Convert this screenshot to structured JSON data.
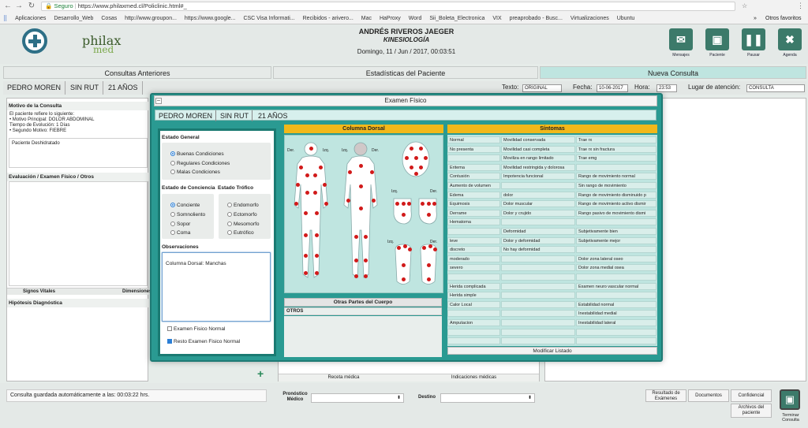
{
  "browser": {
    "secure_label": "Seguro",
    "url": "https://www.philaxmed.cl/Policlinic.html#_",
    "bookmarks": [
      "Aplicaciones",
      "Desarrollo_Web",
      "Cosas",
      "http://www.groupon...",
      "https://www.google...",
      "CSC Visa Informati...",
      "Recibidos - arivero...",
      "Mac",
      "HaProxy",
      "Word",
      "Sii_Boleta_Electronica",
      "VIX",
      "preaprobado - Busc...",
      "Virtualizaciones",
      "Ubuntu"
    ],
    "other_bookmarks": "Otros favoritos",
    "more": "»"
  },
  "brand": {
    "line1": "philax",
    "line2": "med"
  },
  "doctor": {
    "name": "ANDRÉS RIVEROS JAEGER",
    "specialty": "KINESIOLOGÍA",
    "datetime": "Domingo, 11 / Jun / 2017, 00:03:51"
  },
  "toolbar": [
    {
      "label": "Mensajes",
      "icon": "envelope-icon",
      "glyph": "✉"
    },
    {
      "label": "Paciente",
      "icon": "patient-card-icon",
      "glyph": "▣"
    },
    {
      "label": "Pausar",
      "icon": "pause-icon",
      "glyph": "❚❚"
    },
    {
      "label": "Agenda",
      "icon": "close-x-icon",
      "glyph": "✖"
    }
  ],
  "tabs": [
    "Consultas Anteriores",
    "Estadísticas del Paciente",
    "Nueva Consulta"
  ],
  "patient": {
    "name": "PEDRO MOREN",
    "rut": "SIN RUT",
    "age": "21 AÑOS"
  },
  "consult": {
    "texto_label": "Texto:",
    "texto_value": "ORIGINAL",
    "fecha_label": "Fecha:",
    "fecha_value": "10-06-2017",
    "hora_label": "Hora:",
    "hora_value": "23:53",
    "lugar_label": "Lugar de atención:",
    "lugar_value": "CONSULTA"
  },
  "left": {
    "motivo_title": "Motivo de la Consulta",
    "motivo_lines": [
      "El paciente refiere lo siguiente:",
      "• Motivo Principal: DOLOR ABDOMINAL",
      "Tiempo de Evolución: 1 Días",
      "• Segundo Motivo: FIEBRE"
    ],
    "motivo_extra": "Paciente Deshidratado",
    "eval_title": "Evaluación / Examen Físico / Otros",
    "signos": "Signos Vitales",
    "dimensiones": "Dimensiones",
    "hipotesis_title": "Hipótesis Diagnóstica",
    "add": "+"
  },
  "middle_bottom": {
    "receta": "Receta médica",
    "indicaciones": "Indicaciones médicas"
  },
  "footer": {
    "save_msg": "Consulta guardada automáticamente a las: 00:03:22 hrs.",
    "pronostico_label": "Pronóstico Médico",
    "destino_label": "Destino",
    "buttons": [
      "Resultado de Exámenes",
      "Documentos",
      "Confidencial",
      "Archivos del paciente"
    ],
    "terminar": "Terminar Consulta"
  },
  "modal": {
    "title": "Examen Físico",
    "estado_general": {
      "label": "Estado General",
      "options": [
        {
          "label": "Buenas Condiciones",
          "selected": true
        },
        {
          "label": "Regulares Condiciones",
          "selected": false
        },
        {
          "label": "Malas Condiciones",
          "selected": false
        }
      ]
    },
    "conciencia": {
      "label": "Estado de Conciencia",
      "options": [
        {
          "label": "Conciente",
          "selected": true
        },
        {
          "label": "Somnoliento",
          "selected": false
        },
        {
          "label": "Sopor",
          "selected": false
        },
        {
          "label": "Coma",
          "selected": false
        }
      ]
    },
    "trofico": {
      "label": "Estado Trófico",
      "options": [
        {
          "label": "Endomorfo",
          "selected": false
        },
        {
          "label": "Ectomorfo",
          "selected": false
        },
        {
          "label": "Mesomorfo",
          "selected": false
        },
        {
          "label": "Eutrófico",
          "selected": false
        }
      ]
    },
    "observaciones_label": "Observaciones",
    "observaciones_value": "Columna Dorsal: Manchas",
    "checks": [
      {
        "label": "Examen Fisico Normal",
        "checked": false
      },
      {
        "label": "Resto Examen Fisico Normal",
        "checked": true
      }
    ],
    "columna_title": "Columna Dorsal",
    "body_labels": {
      "der": "Der.",
      "izq": "Izq."
    },
    "otras_title": "Otras Partes del Cuerpo",
    "otras_row": "OTROS",
    "sintomas_title": "Síntomas",
    "sintomas": [
      [
        "Normal",
        "No presenta",
        "",
        "Eritema",
        "Contusión",
        "Aumento de volumen",
        "Edema",
        "Equimosis",
        "Derrame",
        "Hematoma",
        "",
        "leve",
        "discreto",
        "moderado",
        "severo",
        "",
        "Herida complicada",
        "Herida simple",
        "Calor Local",
        "",
        "Amputacion",
        "",
        ""
      ],
      [
        "Movilidad conservada",
        "Movilidad casi completa",
        "Moviliza en rango limitado",
        "Movilidad restringida y dolorosa",
        "Impotencia funcional",
        "",
        "dolor",
        "Dolor muscular",
        "Dolor y crujido",
        "",
        "Deformidad",
        "Dolor y deformidad",
        "No hay deformidad",
        "",
        "",
        "",
        "",
        "",
        "",
        "",
        "",
        "",
        ""
      ],
      [
        "Trae rx",
        "Trae rx sin fractura",
        "Trae emg",
        "",
        "Rango de movimiento normal",
        "Sin rango de movimiento",
        "Rango de movimiento disminuido p",
        "Rango de movimiento activo dismir",
        "Rango pasivo de movimiento dismi",
        "",
        "Subjetivamente bien",
        "Subjetivamente mejor",
        "",
        "Dolor zona lateral oseo",
        "Dolor zona medial osea",
        "",
        "Examen neuro vascular normal",
        "",
        "Estabilidad normal",
        "Inestabilidad medial",
        "Inestabilidad lateral",
        "",
        ""
      ]
    ],
    "modificar": "Modificar Listado"
  },
  "colors": {
    "accent": "#2a9a92",
    "yellow": "#f2b81a",
    "dot": "#d11a1a"
  }
}
